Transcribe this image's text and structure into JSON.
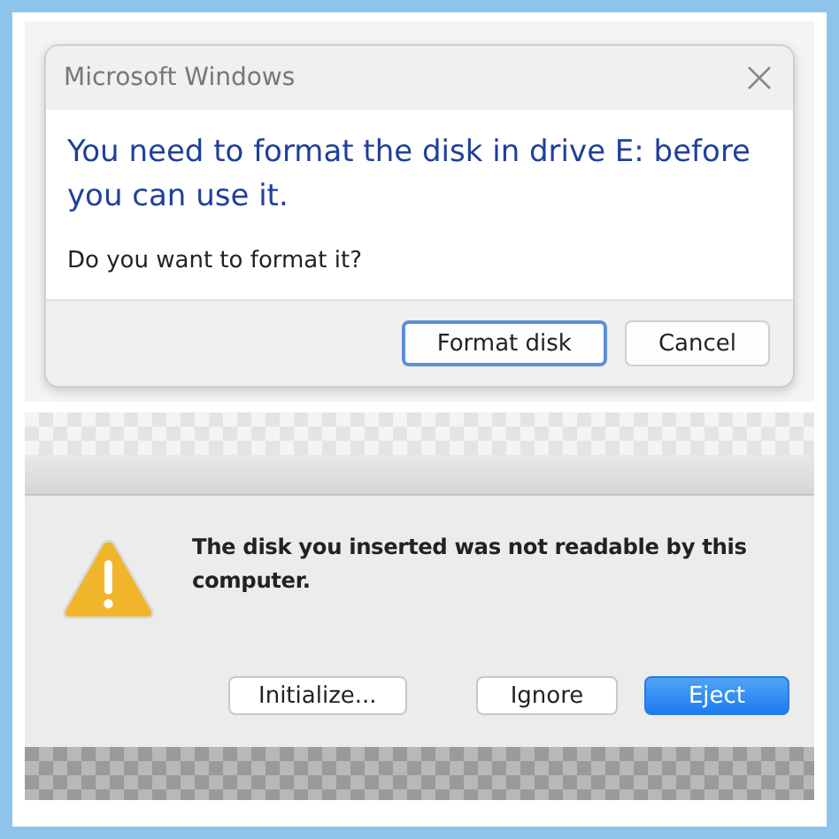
{
  "windows_dialog": {
    "title": "Microsoft Windows",
    "heading": "You need to format the disk in drive E: before you can use it.",
    "message": "Do you want to format it?",
    "buttons": [
      {
        "label": "Format disk",
        "default": true
      },
      {
        "label": "Cancel",
        "default": false
      }
    ]
  },
  "mac_dialog": {
    "message": "The disk you inserted was not readable by this computer.",
    "buttons": [
      {
        "label": "Initialize...",
        "default": false
      },
      {
        "label": "Ignore",
        "default": false
      },
      {
        "label": "Eject",
        "default": true
      }
    ]
  }
}
